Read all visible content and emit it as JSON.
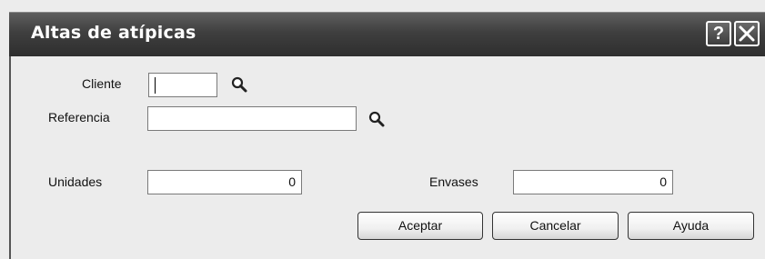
{
  "window": {
    "title": "Altas  de atípicas",
    "help_label": "?",
    "close_label": "✕"
  },
  "form": {
    "cliente": {
      "label": "Cliente",
      "value": "",
      "icon": "search-icon"
    },
    "referencia": {
      "label": "Referencia",
      "value": "",
      "icon": "search-icon"
    },
    "unidades": {
      "label": "Unidades",
      "value": "0"
    },
    "envases": {
      "label": "Envases",
      "value": "0"
    }
  },
  "buttons": {
    "accept": "Aceptar",
    "cancel": "Cancelar",
    "help": "Ayuda"
  }
}
